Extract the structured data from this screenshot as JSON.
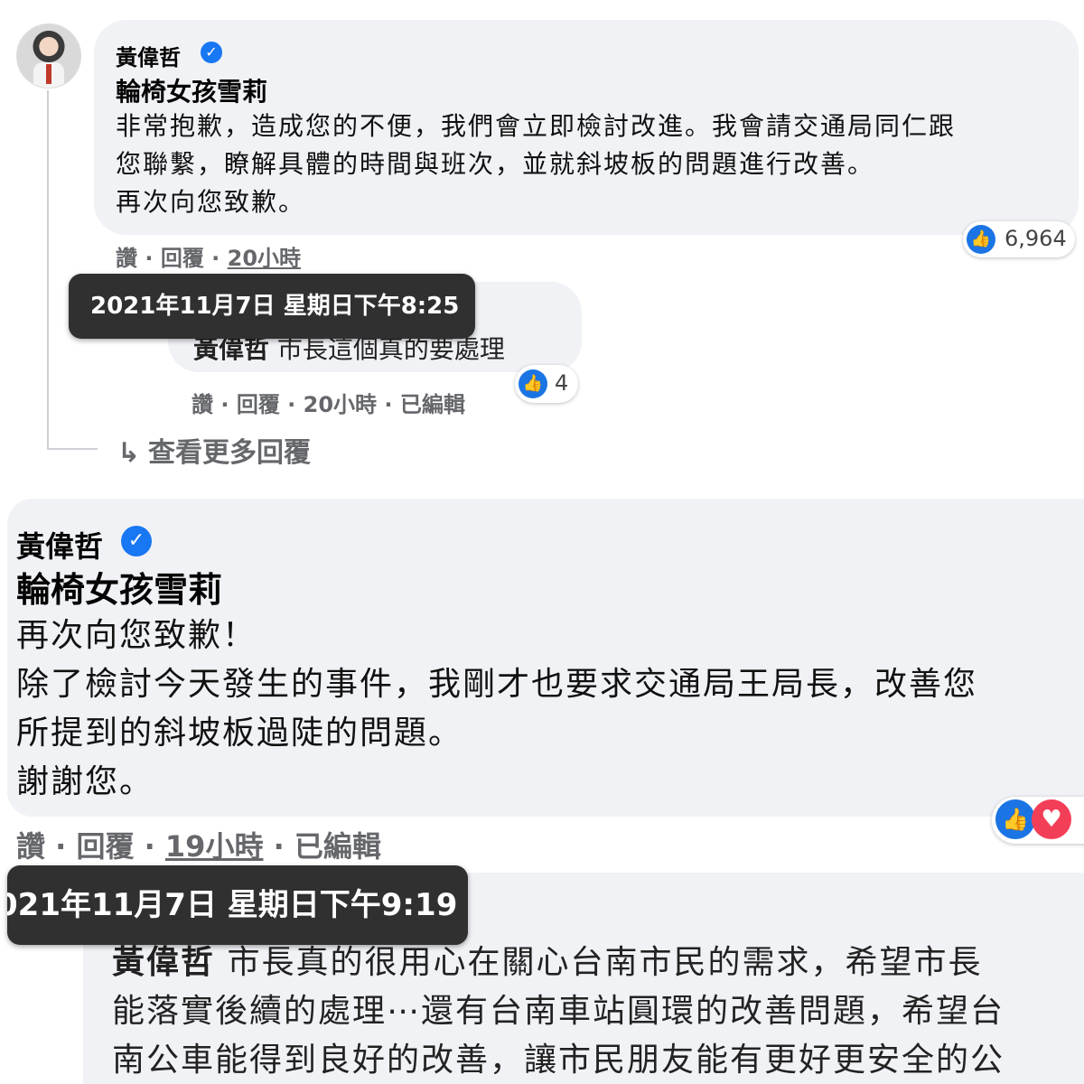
{
  "top_comment": {
    "author": "黃偉哲",
    "mention": "輪椅女孩雪莉",
    "lines": [
      "非常抱歉，造成您的不便，我們會立即檢討改進。我會請交通局同仁跟",
      "您聯繫，瞭解具體的時間與班次，並就斜坡板的問題進行改善。",
      "再次向您致歉。"
    ],
    "reaction_count": "6,964",
    "actions": {
      "like": "讚",
      "reply": "回覆",
      "time": "20小時",
      "sep": " · "
    }
  },
  "tooltip_1": "2021年11月7日 星期日下午8:25",
  "reply": {
    "mention": "黃偉哲",
    "text": " 市長這個真的要處理",
    "reaction_count": "4",
    "actions": {
      "like": "讚",
      "reply": "回覆",
      "time": "20小時",
      "edited": "已編輯"
    }
  },
  "more_replies": "查看更多回覆",
  "second_comment": {
    "author": "黃偉哲",
    "mention": "輪椅女孩雪莉",
    "lines": [
      "再次向您致歉！",
      "除了檢討今天發生的事件，我剛才也要求交通局王局長，改善您",
      "所提到的斜坡板過陡的問題。",
      "謝謝您。"
    ],
    "actions": {
      "like": "讚",
      "reply": "回覆",
      "time": "19小時",
      "edited": "已編輯"
    }
  },
  "tooltip_2": "021年11月7日 星期日下午9:19",
  "third_comment": {
    "mention": "黃偉哲",
    "lines": [
      " 市長真的很用心在關心台南市民的需求，希望市長",
      "能落實後續的處理⋯還有台南車站圓環的改善問題，希望台",
      "南公車能得到良好的改善，讓市民朋友能有更好更安全的公"
    ]
  },
  "icons": {
    "verified": "verified-badge-icon",
    "like": "like-icon",
    "heart": "heart-icon",
    "reply_arrow": "reply-arrow-icon"
  },
  "colors": {
    "bubble": "#f0f2f5",
    "link_blue": "#1877f2",
    "meta_gray": "#65676b",
    "heart_red": "#f33e58"
  }
}
